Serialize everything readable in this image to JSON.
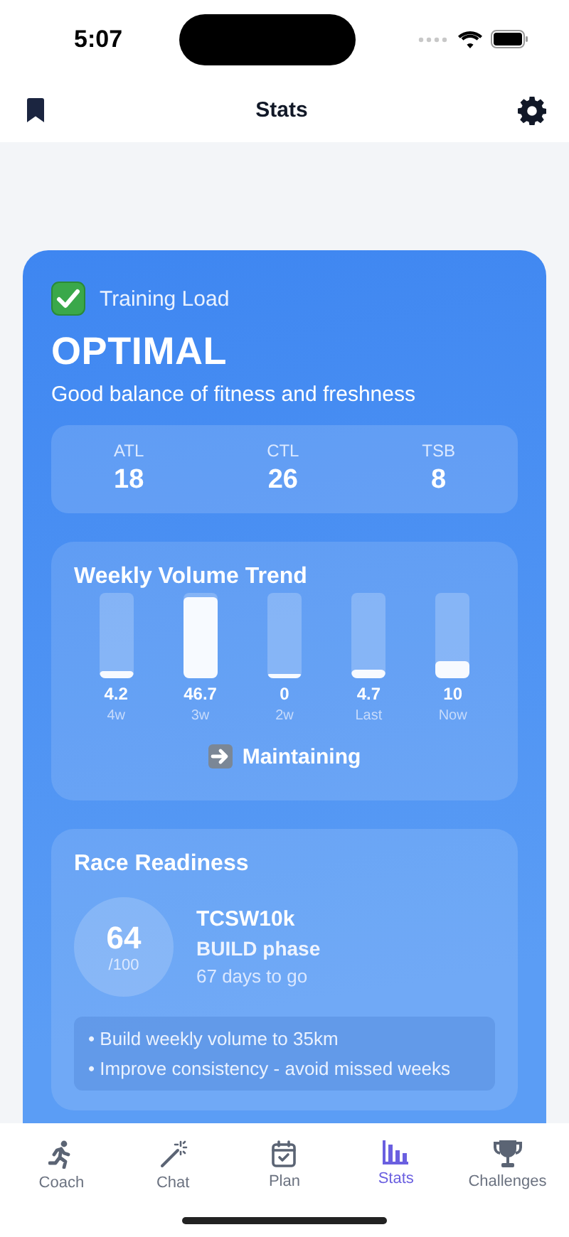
{
  "status_bar": {
    "time": "5:07"
  },
  "header": {
    "title": "Stats"
  },
  "training_load": {
    "title": "Training Load",
    "status": "OPTIMAL",
    "description": "Good balance of fitness and freshness",
    "metrics": [
      {
        "label": "ATL",
        "value": "18"
      },
      {
        "label": "CTL",
        "value": "26"
      },
      {
        "label": "TSB",
        "value": "8"
      }
    ]
  },
  "weekly_volume": {
    "title": "Weekly Volume Trend",
    "weeks": [
      {
        "value": "4.2",
        "label": "4w",
        "level": 0.09
      },
      {
        "value": "46.7",
        "label": "3w",
        "level": 1
      },
      {
        "value": "0",
        "label": "2w",
        "level": 0
      },
      {
        "value": "4.7",
        "label": "Last",
        "level": 0.1
      },
      {
        "value": "10",
        "label": "Now",
        "level": 0.21
      }
    ],
    "trend": "Maintaining"
  },
  "race_readiness": {
    "title": "Race Readiness",
    "score": "64",
    "score_max": "/100",
    "race": "TCSW10k",
    "phase": "BUILD phase",
    "countdown": "67 days to go",
    "tips": [
      "• Build weekly volume to 35km",
      "• Improve consistency - avoid missed weeks"
    ]
  },
  "tab_bar": [
    {
      "label": "Coach",
      "selected": false
    },
    {
      "label": "Chat",
      "selected": false
    },
    {
      "label": "Plan",
      "selected": false
    },
    {
      "label": "Stats",
      "selected": true
    },
    {
      "label": "Challenges",
      "selected": false
    }
  ]
}
